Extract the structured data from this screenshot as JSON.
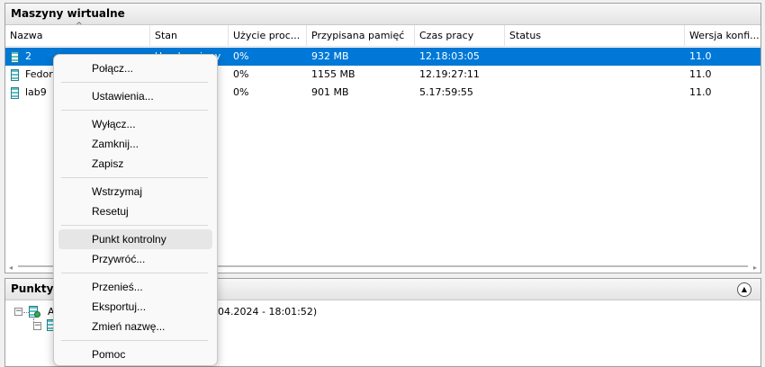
{
  "vm_panel": {
    "title": "Maszyny wirtualne",
    "columns": [
      "Nazwa",
      "Stan",
      "Użycie proc...",
      "Przypisana pamięć",
      "Czas pracy",
      "Status",
      "Wersja konfi..."
    ],
    "sort_indicator": "^",
    "rows": [
      {
        "name": "2",
        "state": "Uruchomiony",
        "cpu": "0%",
        "memory": "932 MB",
        "uptime": "12.18:03:05",
        "status": "",
        "version": "11.0",
        "selected": true
      },
      {
        "name": "Fedora",
        "state": "",
        "cpu": "0%",
        "memory": "1155 MB",
        "uptime": "12.19:27:11",
        "status": "",
        "version": "11.0",
        "selected": false
      },
      {
        "name": "lab9",
        "state": "",
        "cpu": "0%",
        "memory": "901 MB",
        "uptime": "5.17:59:55",
        "status": "",
        "version": "11.0",
        "selected": false
      }
    ]
  },
  "checkpoints_panel": {
    "title": "Punkty k",
    "tree_root_label": "A",
    "tree_root_suffix": "04.2024 - 18:01:52)",
    "collapse_icon": "chevron-up-icon"
  },
  "context_menu": {
    "groups": [
      [
        "Połącz..."
      ],
      [
        "Ustawienia..."
      ],
      [
        "Wyłącz...",
        "Zamknij...",
        "Zapisz"
      ],
      [
        "Wstrzymaj",
        "Resetuj"
      ],
      [
        "Punkt kontrolny",
        "Przywróć..."
      ],
      [
        "Przenieś...",
        "Eksportuj...",
        "Zmień nazwę..."
      ],
      [
        "Pomoc"
      ]
    ],
    "hovered_item": "Punkt kontrolny"
  },
  "colors": {
    "selection": "#0078d7",
    "vm_icon": "#5cc3c8"
  }
}
